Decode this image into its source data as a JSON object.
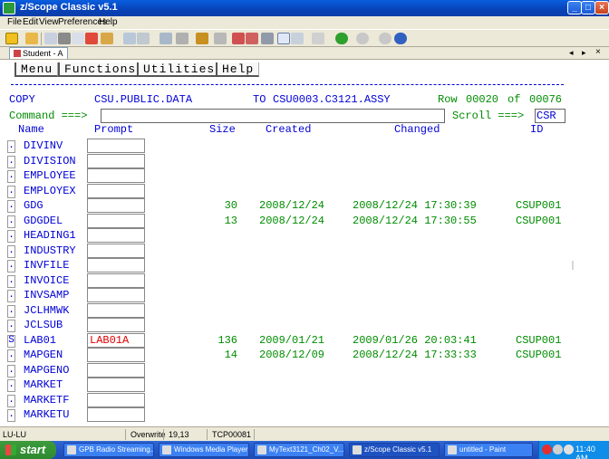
{
  "window": {
    "title": "z/Scope Classic v5.1"
  },
  "menubar": [
    "File",
    "Edit",
    "View",
    "Preferences",
    "Help"
  ],
  "session_tab": "Student - A",
  "terminal": {
    "menu_buttons": [
      "Menu",
      "Functions",
      "Utilities",
      "Help"
    ],
    "header": {
      "copy_label": "COPY",
      "source": "CSU.PUBLIC.DATA",
      "to_label": "TO",
      "target": "CSU0003.C3121.ASSY",
      "row_label": "Row",
      "row_value": "00020",
      "of_label": "of",
      "row_total": "00076"
    },
    "command_label": "Command ===>",
    "command_value": "",
    "scroll_label": "Scroll ===>",
    "scroll_value": "CSR",
    "columns": {
      "name": "Name",
      "prompt": "Prompt",
      "size": "Size",
      "created": "Created",
      "changed": "Changed",
      "id": "ID"
    },
    "rows": [
      {
        "sel": ".",
        "name": "DIVINV",
        "prompt": "",
        "size": "",
        "created": "",
        "changed": "",
        "id": ""
      },
      {
        "sel": ".",
        "name": "DIVISION",
        "prompt": "",
        "size": "",
        "created": "",
        "changed": "",
        "id": ""
      },
      {
        "sel": ".",
        "name": "EMPLOYEE",
        "prompt": "",
        "size": "",
        "created": "",
        "changed": "",
        "id": ""
      },
      {
        "sel": ".",
        "name": "EMPLOYEX",
        "prompt": "",
        "size": "",
        "created": "",
        "changed": "",
        "id": ""
      },
      {
        "sel": ".",
        "name": "GDG",
        "prompt": "",
        "size": "30",
        "created": "2008/12/24",
        "changed": "2008/12/24 17:30:39",
        "id": "CSUP001"
      },
      {
        "sel": ".",
        "name": "GDGDEL",
        "prompt": "",
        "size": "13",
        "created": "2008/12/24",
        "changed": "2008/12/24 17:30:55",
        "id": "CSUP001"
      },
      {
        "sel": ".",
        "name": "HEADING1",
        "prompt": "",
        "size": "",
        "created": "",
        "changed": "",
        "id": ""
      },
      {
        "sel": ".",
        "name": "INDUSTRY",
        "prompt": "",
        "size": "",
        "created": "",
        "changed": "",
        "id": ""
      },
      {
        "sel": ".",
        "name": "INVFILE",
        "prompt": "",
        "size": "",
        "created": "",
        "changed": "",
        "id": ""
      },
      {
        "sel": ".",
        "name": "INVOICE",
        "prompt": "",
        "size": "",
        "created": "",
        "changed": "",
        "id": ""
      },
      {
        "sel": ".",
        "name": "INVSAMP",
        "prompt": "",
        "size": "",
        "created": "",
        "changed": "",
        "id": ""
      },
      {
        "sel": ".",
        "name": "JCLHMWK",
        "prompt": "",
        "size": "",
        "created": "",
        "changed": "",
        "id": ""
      },
      {
        "sel": ".",
        "name": "JCLSUB",
        "prompt": "",
        "size": "",
        "created": "",
        "changed": "",
        "id": ""
      },
      {
        "sel": "S",
        "name": "LAB01",
        "prompt": "LAB01A",
        "size": "136",
        "created": "2009/01/21",
        "changed": "2009/01/26 20:03:41",
        "id": "CSUP001"
      },
      {
        "sel": ".",
        "name": "MAPGEN",
        "prompt": "",
        "size": "14",
        "created": "2008/12/09",
        "changed": "2008/12/24 17:33:33",
        "id": "CSUP001"
      },
      {
        "sel": ".",
        "name": "MAPGENO",
        "prompt": "",
        "size": "",
        "created": "",
        "changed": "",
        "id": ""
      },
      {
        "sel": ".",
        "name": "MARKET",
        "prompt": "",
        "size": "",
        "created": "",
        "changed": "",
        "id": ""
      },
      {
        "sel": ".",
        "name": "MARKETF",
        "prompt": "",
        "size": "",
        "created": "",
        "changed": "",
        "id": ""
      },
      {
        "sel": ".",
        "name": "MARKETU",
        "prompt": "",
        "size": "",
        "created": "",
        "changed": "",
        "id": ""
      }
    ]
  },
  "statusbar": {
    "lu": "LU-LU",
    "mode": "Overwrite",
    "cursor": "19,13",
    "connection": "TCP00081"
  },
  "taskbar": {
    "start": "start",
    "tasks": [
      {
        "label": "GPB Radio Streaming...",
        "active": false
      },
      {
        "label": "Windows Media Player",
        "active": false
      },
      {
        "label": "MyText3121_Ch02_V...",
        "active": false
      },
      {
        "label": "z/Scope Classic v5.1",
        "active": true
      },
      {
        "label": "untitled - Paint",
        "active": false
      }
    ],
    "clock": "11:40 AM"
  },
  "colors": {
    "field_blue": "#0000d8",
    "data_green": "#008c00",
    "selected_red": "#e00000"
  }
}
